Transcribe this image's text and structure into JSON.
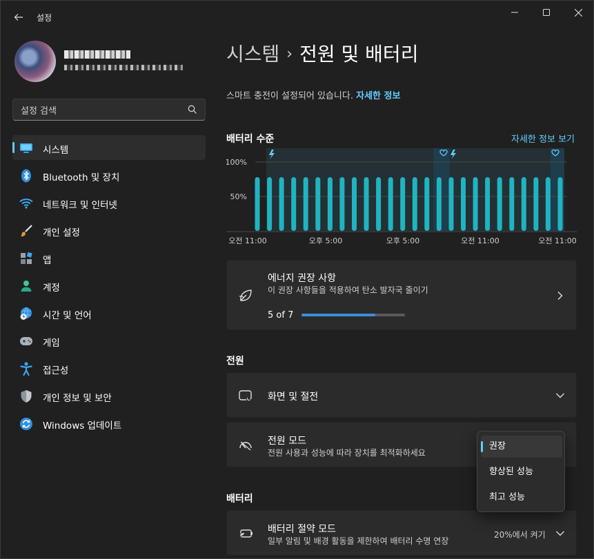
{
  "window": {
    "title": "설정"
  },
  "search": {
    "placeholder": "설정 검색"
  },
  "sidebar": {
    "items": [
      {
        "label": "시스템",
        "icon": "system-icon",
        "selected": true
      },
      {
        "label": "Bluetooth 및 장치",
        "icon": "bluetooth-icon"
      },
      {
        "label": "네트워크 및 인터넷",
        "icon": "wifi-icon"
      },
      {
        "label": "개인 설정",
        "icon": "brush-icon"
      },
      {
        "label": "앱",
        "icon": "apps-icon"
      },
      {
        "label": "계정",
        "icon": "account-icon"
      },
      {
        "label": "시간 및 언어",
        "icon": "globe-clock-icon"
      },
      {
        "label": "게임",
        "icon": "gamepad-icon"
      },
      {
        "label": "접근성",
        "icon": "accessibility-icon"
      },
      {
        "label": "개인 정보 및 보안",
        "icon": "shield-icon"
      },
      {
        "label": "Windows 업데이트",
        "icon": "update-icon"
      }
    ]
  },
  "header": {
    "parent": "시스템",
    "separator": "›",
    "current": "전원 및 배터리"
  },
  "notice": {
    "text": "스마트 충전이 설정되어 있습니다. ",
    "link": "자세한 정보"
  },
  "battery_level": {
    "title": "배터리 수준",
    "details_link": "자세한 정보 보기",
    "y_ticks": [
      "100%",
      "50%"
    ],
    "x_ticks": [
      "오전 11:00",
      "오후 5:00",
      "오후 5:00",
      "오전 11:00",
      "오전 11:00"
    ],
    "markers": [
      "charging-icon",
      "heart-icon",
      "charging-icon",
      "heart-icon"
    ],
    "bar_count": 26,
    "level_percent": 78
  },
  "energy": {
    "title": "에너지 권장 사항",
    "subtitle": "이 권장 사항들을 적용하여 탄소 발자국 줄이기",
    "progress_text": "5 of 7",
    "progress_done": 5,
    "progress_total": 7
  },
  "power_section": {
    "title": "전원"
  },
  "screen_sleep": {
    "title": "화면 및 절전"
  },
  "power_mode": {
    "title": "전원 모드",
    "subtitle": "전원 사용과 성능에 따라 장치를 최적화하세요",
    "options": [
      "권장",
      "향상된 성능",
      "최고 성능"
    ],
    "selected": "권장"
  },
  "battery_section": {
    "title": "배터리"
  },
  "battery_saver": {
    "title": "배터리 절약 모드",
    "subtitle": "일부 알림 및 배경 활동을 제한하여 배터리 수명 연장",
    "value": "20%에서 켜기"
  },
  "colors": {
    "accent": "#60cdff",
    "bar": "#1fb4c2",
    "progress": "#3b8ddd"
  }
}
